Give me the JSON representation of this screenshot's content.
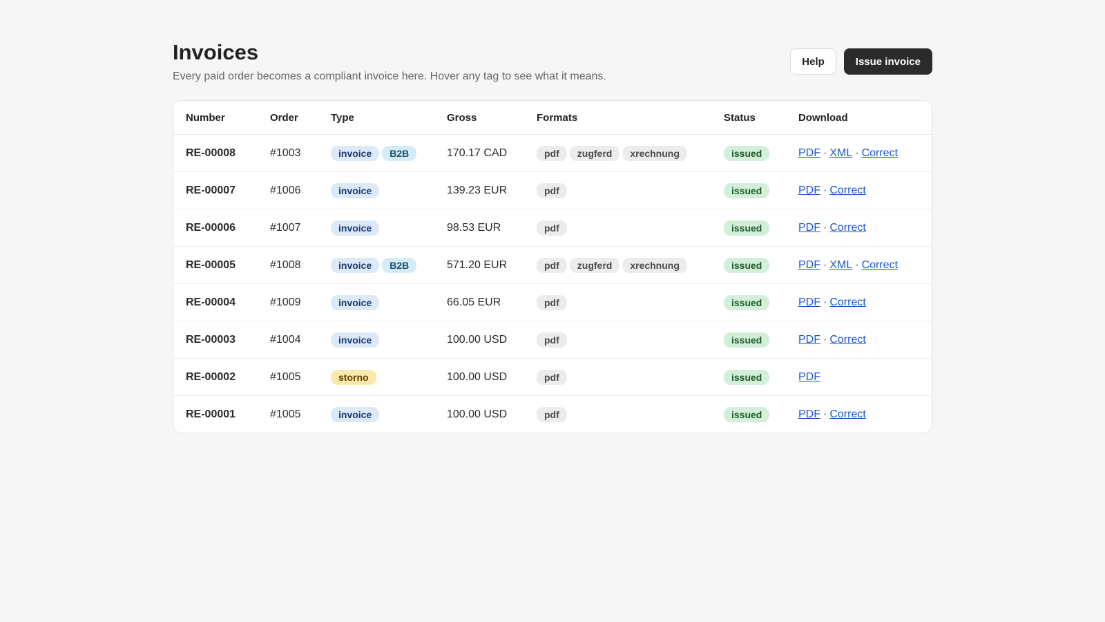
{
  "header": {
    "title": "Invoices",
    "subtitle": "Every paid order becomes a compliant invoice here. Hover any tag to see what it means.",
    "help_label": "Help",
    "issue_label": "Issue invoice"
  },
  "table": {
    "columns": [
      "Number",
      "Order",
      "Type",
      "Gross",
      "Formats",
      "Status",
      "Download"
    ],
    "rows": [
      {
        "number": "RE-00008",
        "order": "#1003",
        "types": [
          "invoice",
          "B2B"
        ],
        "gross": "170.17 CAD",
        "formats": [
          "pdf",
          "zugferd",
          "xrechnung"
        ],
        "status": "issued",
        "links": [
          "PDF",
          "XML",
          "Correct"
        ]
      },
      {
        "number": "RE-00007",
        "order": "#1006",
        "types": [
          "invoice"
        ],
        "gross": "139.23 EUR",
        "formats": [
          "pdf"
        ],
        "status": "issued",
        "links": [
          "PDF",
          "Correct"
        ]
      },
      {
        "number": "RE-00006",
        "order": "#1007",
        "types": [
          "invoice"
        ],
        "gross": "98.53 EUR",
        "formats": [
          "pdf"
        ],
        "status": "issued",
        "links": [
          "PDF",
          "Correct"
        ]
      },
      {
        "number": "RE-00005",
        "order": "#1008",
        "types": [
          "invoice",
          "B2B"
        ],
        "gross": "571.20 EUR",
        "formats": [
          "pdf",
          "zugferd",
          "xrechnung"
        ],
        "status": "issued",
        "links": [
          "PDF",
          "XML",
          "Correct"
        ]
      },
      {
        "number": "RE-00004",
        "order": "#1009",
        "types": [
          "invoice"
        ],
        "gross": "66.05 EUR",
        "formats": [
          "pdf"
        ],
        "status": "issued",
        "links": [
          "PDF",
          "Correct"
        ]
      },
      {
        "number": "RE-00003",
        "order": "#1004",
        "types": [
          "invoice"
        ],
        "gross": "100.00 USD",
        "formats": [
          "pdf"
        ],
        "status": "issued",
        "links": [
          "PDF",
          "Correct"
        ]
      },
      {
        "number": "RE-00002",
        "order": "#1005",
        "types": [
          "storno"
        ],
        "gross": "100.00 USD",
        "formats": [
          "pdf"
        ],
        "status": "issued",
        "links": [
          "PDF"
        ]
      },
      {
        "number": "RE-00001",
        "order": "#1005",
        "types": [
          "invoice"
        ],
        "gross": "100.00 USD",
        "formats": [
          "pdf"
        ],
        "status": "issued",
        "links": [
          "PDF",
          "Correct"
        ]
      }
    ]
  },
  "colors": {
    "background": "#f6f6f6",
    "primary_button": "#2b2b2b",
    "link": "#1a55c9",
    "invoice_tag": "#dde9f9",
    "b2b_tag": "#d3ecf8",
    "storno_tag": "#fbe9ad",
    "format_tag": "#ececec",
    "issued_tag": "#d3efda"
  }
}
